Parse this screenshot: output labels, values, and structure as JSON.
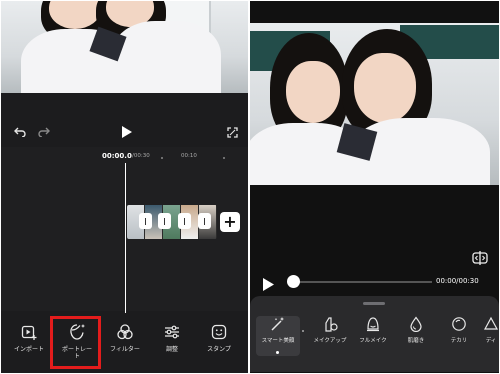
{
  "left_editor": {
    "timeline": {
      "current_time": "00:00.0",
      "duration": "/00:30",
      "tick_10": "00:10"
    },
    "add_clip_label": "+",
    "tools": [
      {
        "label": "インポート",
        "icon": "import-icon"
      },
      {
        "label": "ポートレート",
        "icon": "portrait-icon"
      },
      {
        "label": "フィルター",
        "icon": "filter-icon"
      },
      {
        "label": "調整",
        "icon": "adjust-icon"
      },
      {
        "label": "スタンプ",
        "icon": "sticker-icon"
      }
    ],
    "highlight_color": "#e31c1c"
  },
  "right_editor": {
    "time_display": "00:00/00:30",
    "tools": [
      {
        "label": "スマート美顔",
        "icon": "magic-wand-icon",
        "active": true
      },
      {
        "label": "メイクアップ",
        "icon": "makeup-icon"
      },
      {
        "label": "フルメイク",
        "icon": "full-makeup-icon"
      },
      {
        "label": "肌磨き",
        "icon": "skin-smooth-icon"
      },
      {
        "label": "テカリ",
        "icon": "shine-icon"
      },
      {
        "label": "ディ",
        "icon": "detail-icon"
      }
    ]
  }
}
